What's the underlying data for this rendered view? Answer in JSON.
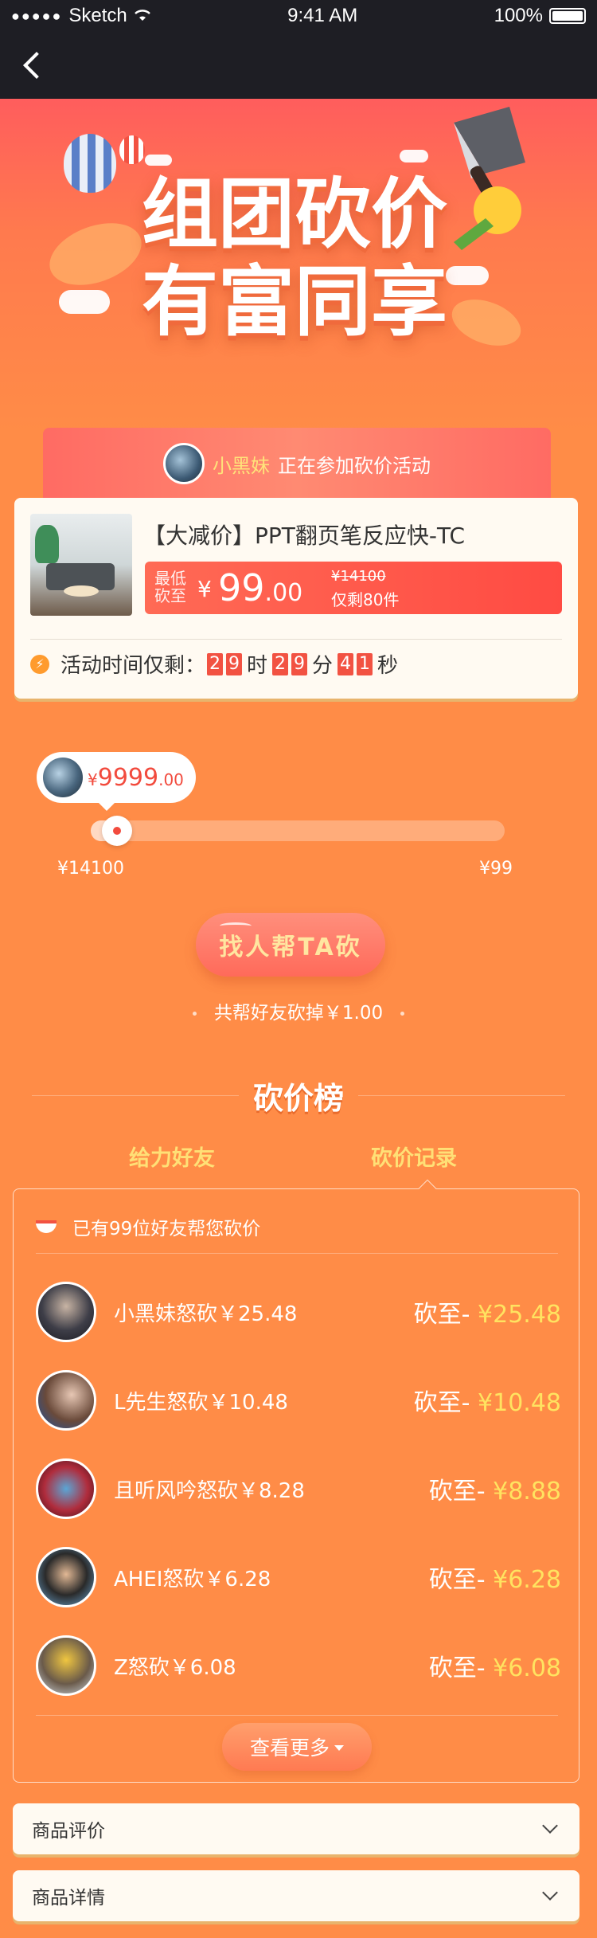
{
  "status_bar": {
    "signal": "●●●●●",
    "carrier": "Sketch",
    "time": "9:41 AM",
    "battery": "100%"
  },
  "hero": {
    "title_line1": "组团砍价",
    "title_line2": "有富同享"
  },
  "participant": {
    "name": "小黑妹",
    "text": "正在参加砍价活动"
  },
  "product": {
    "title": "【大减价】PPT翻页笔反应快-TC",
    "lowest_label": "最低砍至",
    "currency": "¥",
    "price_int": "99",
    "price_dec": ".00",
    "original_price": "¥14100",
    "stock": "仅剩80件",
    "timer_label": "活动时间仅剩：",
    "hours": [
      "2",
      "9"
    ],
    "hour_unit": "时",
    "minutes": [
      "2",
      "9"
    ],
    "minute_unit": "分",
    "seconds": [
      "4",
      "1"
    ],
    "second_unit": "秒"
  },
  "progress": {
    "current_currency": "¥",
    "current_int": "9999",
    "current_dec": ".00",
    "start_label": "¥14100",
    "end_label": "¥99",
    "fraction": 0.03
  },
  "help_button": "找人帮TA砍",
  "friends_total": "共帮好友砍掉￥1.00",
  "rank": {
    "title": "砍价榜",
    "tabs": [
      "给力好友",
      "砍价记录"
    ],
    "summary": "已有99位好友帮您砍价",
    "rows": [
      {
        "who": "小黑妹怒砍￥25.48",
        "result_label": "砍至- ",
        "result_value": "¥25.48"
      },
      {
        "who": "L先生怒砍￥10.48",
        "result_label": "砍至- ",
        "result_value": "¥10.48"
      },
      {
        "who": "且听风吟怒砍￥8.28",
        "result_label": "砍至- ",
        "result_value": "¥8.88"
      },
      {
        "who": "AHEI怒砍￥6.28",
        "result_label": "砍至- ",
        "result_value": "¥6.28"
      },
      {
        "who": "Z怒砍￥6.08",
        "result_label": "砍至- ",
        "result_value": "¥6.08"
      }
    ],
    "more": "查看更多"
  },
  "sections": {
    "reviews": "商品评价",
    "details": "商品详情"
  },
  "colors": {
    "background": "#ff8c47",
    "accent_red": "#f24b3e",
    "highlight_yellow": "#ffe360"
  }
}
